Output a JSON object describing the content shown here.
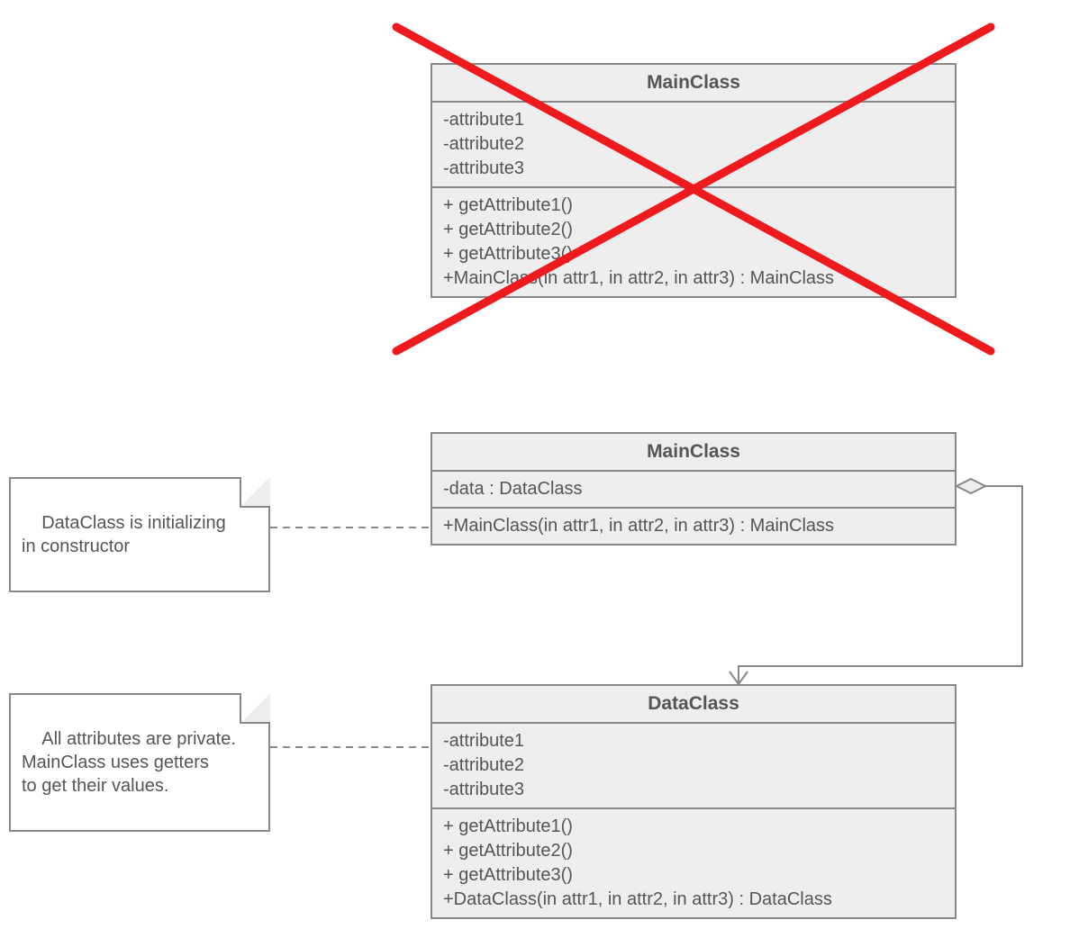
{
  "top_class": {
    "name": "MainClass",
    "attributes": [
      "-attribute1",
      "-attribute2",
      "-attribute3"
    ],
    "operations": [
      "+ getAttribute1()",
      "+ getAttribute2()",
      "+ getAttribute3()",
      "+MainClass(in attr1, in attr2, in attr3) : MainClass"
    ]
  },
  "mid_class": {
    "name": "MainClass",
    "attributes": [
      "-data : DataClass"
    ],
    "operations": [
      "+MainClass(in attr1, in attr2, in attr3) : MainClass"
    ]
  },
  "bottom_class": {
    "name": "DataClass",
    "attributes": [
      "-attribute1",
      "-attribute2",
      "-attribute3"
    ],
    "operations": [
      "+ getAttribute1()",
      "+ getAttribute2()",
      "+ getAttribute3()",
      "+DataClass(in attr1, in attr2, in attr3) : DataClass"
    ]
  },
  "note1": {
    "text": "DataClass is initializing\nin constructor"
  },
  "note2": {
    "text": "All attributes are private.\nMainClass uses getters\nto get their values."
  }
}
